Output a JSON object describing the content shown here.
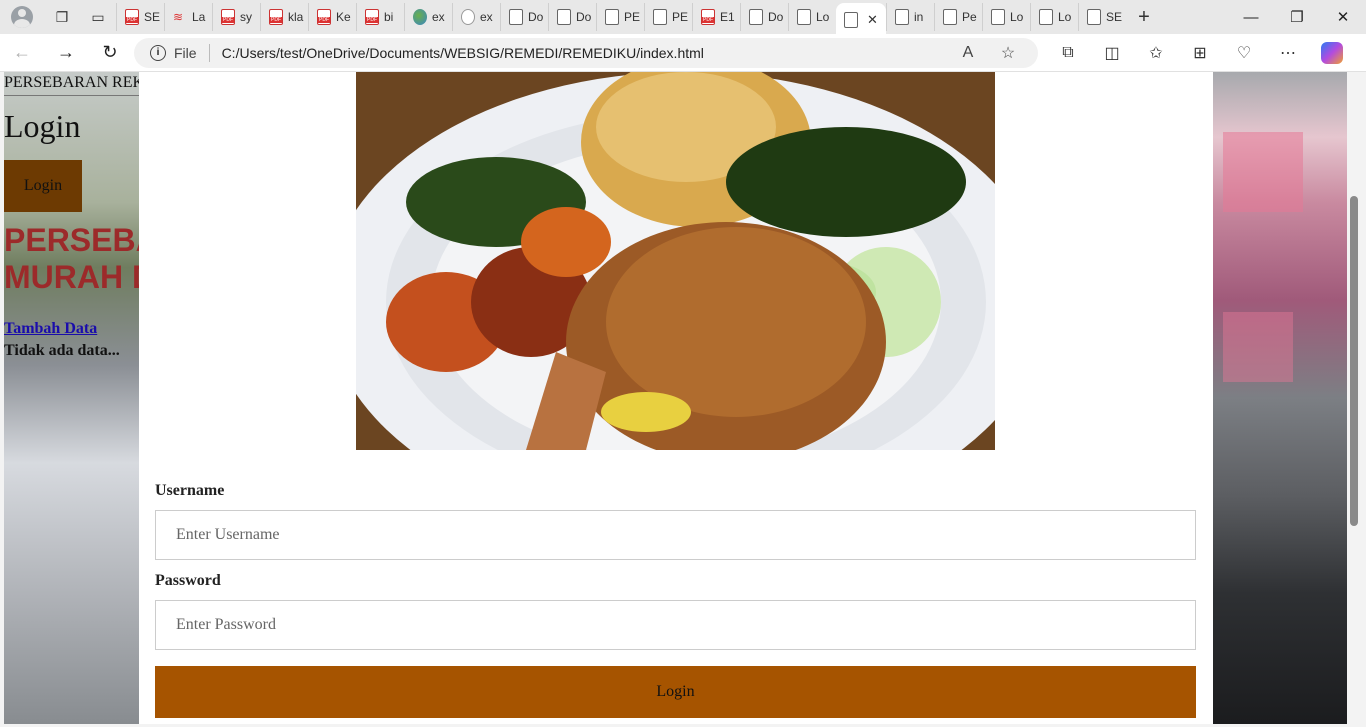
{
  "browser": {
    "tabs": [
      {
        "label": "SE",
        "icon": "pdf-icon"
      },
      {
        "label": "La",
        "icon": "wifi-icon"
      },
      {
        "label": "sy",
        "icon": "pdf-icon"
      },
      {
        "label": "kla",
        "icon": "pdf-icon"
      },
      {
        "label": "Ke",
        "icon": "pdf-icon"
      },
      {
        "label": "bi",
        "icon": "pdf-icon"
      },
      {
        "label": "ex",
        "icon": "globe-icon"
      },
      {
        "label": "ex",
        "icon": "network-icon"
      },
      {
        "label": "Do",
        "icon": "document-icon"
      },
      {
        "label": "Do",
        "icon": "document-icon"
      },
      {
        "label": "PE",
        "icon": "document-icon"
      },
      {
        "label": "PE",
        "icon": "document-icon"
      },
      {
        "label": "E1",
        "icon": "pdf-icon"
      },
      {
        "label": "Do",
        "icon": "document-icon"
      },
      {
        "label": "Lo",
        "icon": "document-icon"
      }
    ],
    "active_tab_close": "✕",
    "tabs_after": [
      {
        "label": "in",
        "icon": "document-icon"
      },
      {
        "label": "Pe",
        "icon": "document-icon"
      },
      {
        "label": "Lo",
        "icon": "document-icon"
      },
      {
        "label": "Lo",
        "icon": "document-icon"
      },
      {
        "label": "SE",
        "icon": "document-icon"
      }
    ],
    "new_tab": "+",
    "address": {
      "scheme_label": "File",
      "url": "C:/Users/test/OneDrive/Documents/WEBSIG/REMEDI/REMEDIKU/index.html"
    }
  },
  "page": {
    "site_title": "PERSEBARAN REKOMENDASI",
    "login_heading": "Login",
    "login_button": "Login",
    "big_title_line1": "PERSEBARAN",
    "big_title_line2": "MURAH DI",
    "add_data_link": "Tambah Data",
    "no_data_text": "Tidak ada data..."
  },
  "login_form": {
    "username_label": "Username",
    "username_placeholder": "Enter Username",
    "password_label": "Password",
    "password_placeholder": "Enter Password",
    "submit_label": "Login"
  },
  "colors": {
    "submit_button": "#a65400",
    "small_login_button": "#6d3a02",
    "title_red": "#9c2a2a",
    "link": "#1a0dab"
  }
}
